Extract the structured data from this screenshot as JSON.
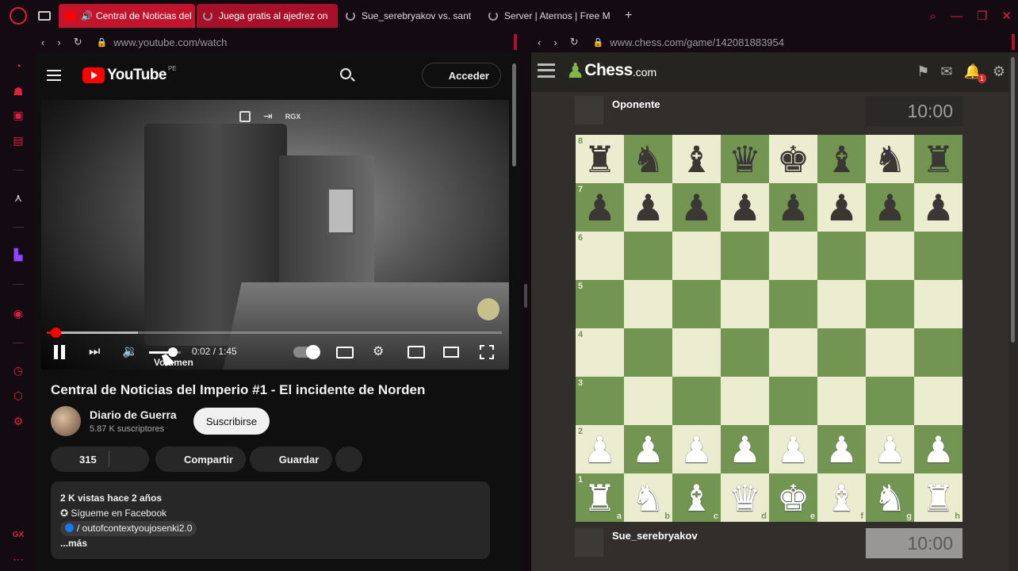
{
  "tabs": [
    {
      "label": "Central de Noticias del",
      "state": "active"
    },
    {
      "label": "Juega gratis al ajedrez on",
      "state": "loading"
    },
    {
      "label": "Sue_serebryakov vs. sant",
      "state": "loading"
    },
    {
      "label": "Server | Aternos | Free M",
      "state": "loading"
    }
  ],
  "newtab_label": "+",
  "left_address": {
    "url": "www.youtube.com/watch"
  },
  "right_address": {
    "url": "www.chess.com/game/142081883954"
  },
  "youtube": {
    "logo_text": "YouTube",
    "region": "PE",
    "signin_label": "Acceder",
    "overlay_badge": "RGX",
    "volume_tooltip": "Volumen",
    "progress_fraction": 0.019,
    "buffer_fraction": 0.2,
    "volume_fraction": 0.75,
    "time": "0:02 / 1:45",
    "title": "Central de Noticias del Imperio #1 - El incidente de Norden",
    "channel": "Diario de Guerra",
    "subscribers": "5.87 K suscriptores",
    "subscribe_label": "Suscribirse",
    "likes": "315",
    "share_label": "Compartir",
    "save_label": "Guardar",
    "description": {
      "stats": "2 K vistas  hace 2 años",
      "line1": "✪ Sígueme en Facebook",
      "fb_link": "/ outofcontextyoujosenki2.0",
      "more": "...más"
    }
  },
  "chess": {
    "logo_word": "Chess",
    "logo_tld": ".com",
    "notification_count": "1",
    "top_player": "Oponente",
    "top_clock": "10:00",
    "bottom_player": "Sue_serebryakov",
    "bottom_clock": "10:00",
    "board": [
      [
        "bR",
        "bN",
        "bB",
        "bQ",
        "bK",
        "bB",
        "bN",
        "bR"
      ],
      [
        "bP",
        "bP",
        "bP",
        "bP",
        "bP",
        "bP",
        "bP",
        "bP"
      ],
      [
        "",
        "",
        "",
        "",
        "",
        "",
        "",
        ""
      ],
      [
        "",
        "",
        "",
        "",
        "",
        "",
        "",
        ""
      ],
      [
        "",
        "",
        "",
        "",
        "",
        "",
        "",
        ""
      ],
      [
        "",
        "",
        "",
        "",
        "",
        "",
        "",
        ""
      ],
      [
        "wP",
        "wP",
        "wP",
        "wP",
        "wP",
        "wP",
        "wP",
        "wP"
      ],
      [
        "wR",
        "wN",
        "wB",
        "wQ",
        "wK",
        "wB",
        "wN",
        "wR"
      ]
    ],
    "ranks": [
      "8",
      "7",
      "6",
      "5",
      "4",
      "3",
      "2",
      "1"
    ],
    "files": [
      "a",
      "b",
      "c",
      "d",
      "e",
      "f",
      "g",
      "h"
    ]
  },
  "colors": {
    "accent": "#e0203c",
    "board_light": "#ebecd0",
    "board_dark": "#739552"
  }
}
